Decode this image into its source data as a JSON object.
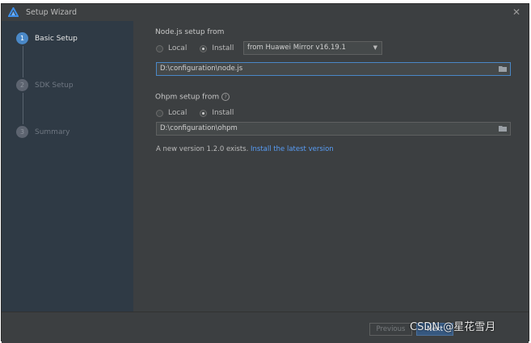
{
  "window": {
    "title": "Setup Wizard",
    "close_glyph": "✕"
  },
  "sidebar": {
    "steps": [
      {
        "number": "1",
        "label": "Basic Setup",
        "state": "active"
      },
      {
        "number": "2",
        "label": "SDK Setup",
        "state": "inactive"
      },
      {
        "number": "3",
        "label": "Summary",
        "state": "inactive"
      }
    ]
  },
  "node": {
    "label": "Node.js setup from",
    "option_local": "Local",
    "option_install": "Install",
    "selected": "install",
    "mirror_select": "from Huawei Mirror v16.19.1",
    "path": "D:\\configuration\\node.js"
  },
  "ohpm": {
    "label": "Ohpm setup from",
    "help_glyph": "?",
    "option_local": "Local",
    "option_install": "Install",
    "selected": "install",
    "path": "D:\\configuration\\ohpm"
  },
  "notice": {
    "text": "A new version 1.2.0 exists. ",
    "link": "Install the latest version"
  },
  "footer": {
    "previous": "Previous",
    "next": "Next"
  },
  "watermark": "CSDN @星花雪月",
  "colors": {
    "accent": "#4a88c7",
    "link": "#589df6",
    "background": "#3c3f41",
    "sidebar": "#2f3a45"
  },
  "icons": {
    "app": "harmony-logo-icon",
    "folder": "folder-icon",
    "dropdown": "chevron-down-icon"
  }
}
